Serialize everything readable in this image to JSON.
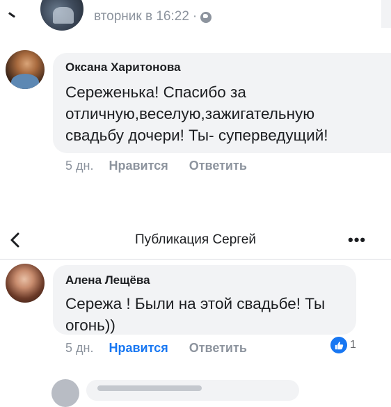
{
  "top_post": {
    "timestamp": "вторник в 16:22",
    "separator": "·",
    "privacy_icon": "globe-icon"
  },
  "comments": [
    {
      "author": "Оксана Харитонова",
      "lines": [
        "Сереженька! Спасибо за",
        "отличную,веселую,зажигательную",
        "свадьбу дочери! Ты- суперведущий!"
      ],
      "time": "5 дн.",
      "like_label": "Нравится",
      "reply_label": "Ответить",
      "liked": false
    },
    {
      "author": "Алена Лещёва",
      "lines": [
        "Сережа ! Были на этой свадьбе! Ты",
        "огонь))"
      ],
      "time": "5 дн.",
      "like_label": "Нравится",
      "reply_label": "Ответить",
      "liked": true,
      "reaction_count": "1"
    }
  ],
  "header": {
    "title": "Публикация Сергей",
    "back_icon": "chevron-left-icon",
    "more_label": "•••"
  },
  "colors": {
    "accent": "#1877f2",
    "bubble": "#f2f3f5",
    "muted_text": "#8d949e",
    "text": "#1c1e21"
  }
}
